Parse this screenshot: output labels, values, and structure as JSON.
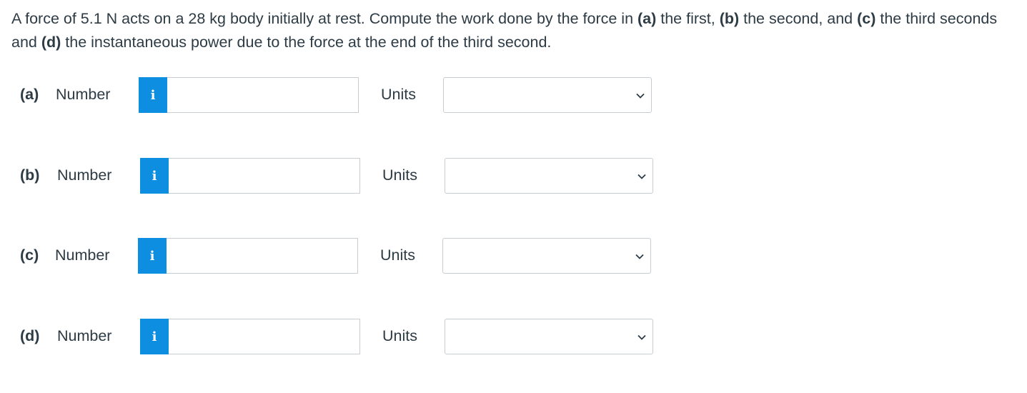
{
  "question": {
    "text_1": "A force of 5.1 N acts on a 28 kg body initially at rest. Compute the work done by the force in ",
    "part_a": "(a)",
    "text_2": " the first, ",
    "part_b": "(b)",
    "text_3": " the second, and ",
    "part_c": "(c)",
    "text_4": " the third seconds and ",
    "part_d": "(d)",
    "text_5": " the instantaneous power due to the force at the end of the third second."
  },
  "answers": [
    {
      "part": "(a)",
      "number_label": "Number",
      "info_icon": "i",
      "number_value": "",
      "units_label": "Units",
      "units_selected": ""
    },
    {
      "part": "(b)",
      "number_label": "Number",
      "info_icon": "i",
      "number_value": "",
      "units_label": "Units",
      "units_selected": ""
    },
    {
      "part": "(c)",
      "number_label": "Number",
      "info_icon": "i",
      "number_value": "",
      "units_label": "Units",
      "units_selected": ""
    },
    {
      "part": "(d)",
      "number_label": "Number",
      "info_icon": "i",
      "number_value": "",
      "units_label": "Units",
      "units_selected": ""
    }
  ],
  "colors": {
    "info_button": "#0e8ee0",
    "text": "#2d3b45",
    "input_border": "#c7cdd1"
  }
}
